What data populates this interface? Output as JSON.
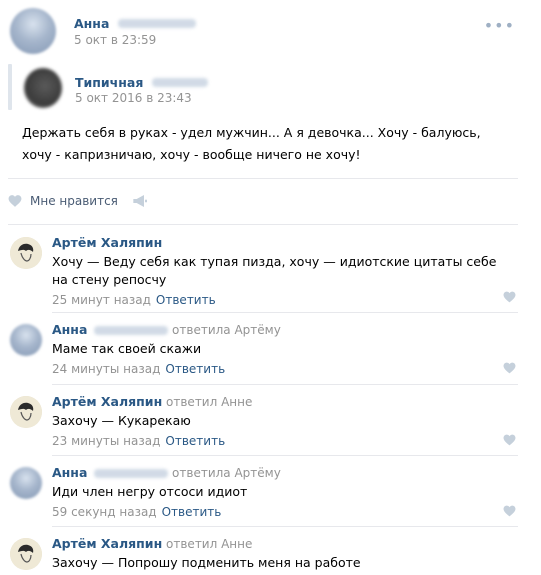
{
  "post": {
    "author": "Анна",
    "date": "5 окт в 23:59",
    "more_icon": "more-dots-icon",
    "repost": {
      "author": "Типичная",
      "date": "5 окт 2016 в 23:43"
    },
    "text": "Держать себя в руках - удел мужчин... А я девочка... Хочу - балуюсь, хочу - капризничаю, хочу - вообще ничего не хочу!",
    "like_label": "Мне нравится"
  },
  "comments": [
    {
      "author": "Артём Халяпин",
      "reply_to": "",
      "text": "Хочу — Веду себя как тупая пизда, хочу — идиотские цитаты себе на стену репосчу",
      "time": "25 минут назад",
      "reply_label": "Ответить"
    },
    {
      "author": "Анна",
      "reply_to": "ответила Артёму",
      "text": "Маме так своей скажи",
      "time": "24 минуты назад",
      "reply_label": "Ответить"
    },
    {
      "author": "Артём Халяпин",
      "reply_to": "ответил Анне",
      "text": "Захочу — Кукарекаю",
      "time": "23 минуты назад",
      "reply_label": "Ответить"
    },
    {
      "author": "Анна",
      "reply_to": "ответила Артёму",
      "text": "Иди член негру отсоси идиот",
      "time": "59 секунд назад",
      "reply_label": "Ответить"
    },
    {
      "author": "Артём Халяпин",
      "reply_to": "ответил Анне",
      "text": "Захочу — Попрошу подменить меня на работе",
      "time": "",
      "reply_label": ""
    }
  ],
  "colors": {
    "link": "#2a5885",
    "meta": "#939393",
    "divider": "#e7e8ec",
    "heart": "#c5d0db"
  }
}
